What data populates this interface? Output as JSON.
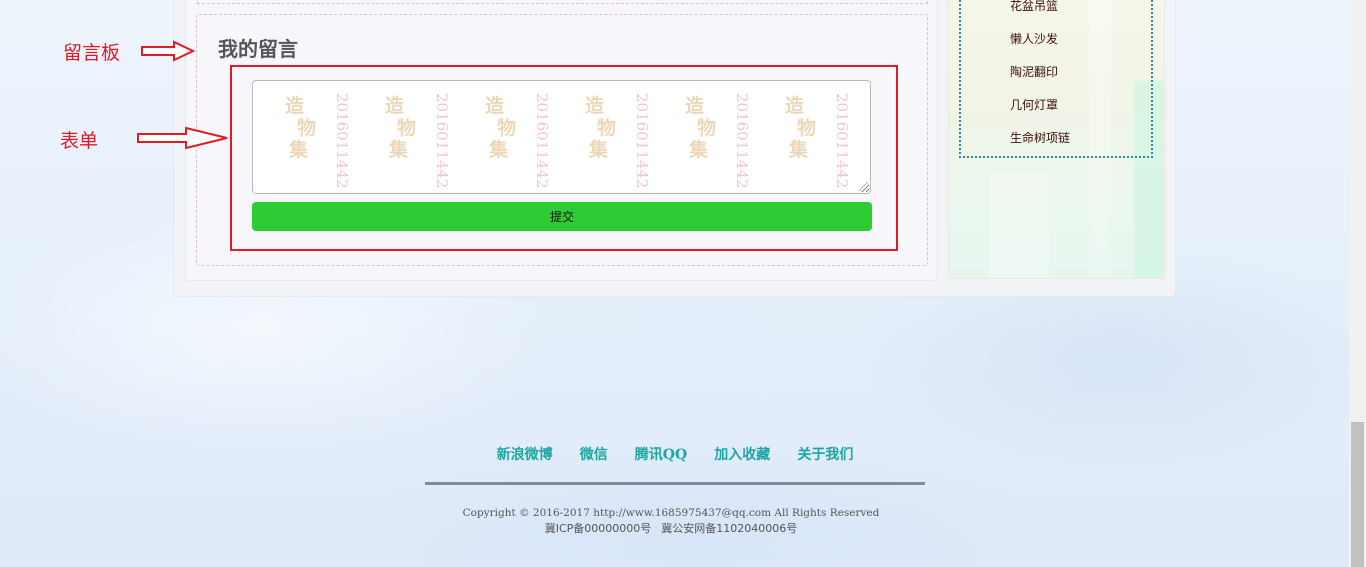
{
  "guestbook": {
    "title": "我的留言",
    "submit_label": "提交"
  },
  "watermark": {
    "logo_chars": [
      "造",
      "物",
      "集"
    ],
    "id_text": "2016011442"
  },
  "annotations": {
    "guestbook_label": "留言板",
    "form_label": "表单",
    "color": "#e01b24"
  },
  "sidebar": {
    "items": [
      {
        "label": "花盆吊篮"
      },
      {
        "label": "懒人沙发"
      },
      {
        "label": "陶泥翻印"
      },
      {
        "label": "几何灯罩"
      },
      {
        "label": "生命树项链"
      }
    ]
  },
  "footer": {
    "links": [
      "新浪微博",
      "微信",
      "腾讯QQ",
      "加入收藏",
      "关于我们"
    ],
    "copyright": "Copyright © 2016-2017 http://www.1685975437@qq.com All Rights Reserved",
    "icp": "冀ICP备00000000号",
    "police": "冀公安网备1102040006号"
  },
  "colors": {
    "submit_button": "#2ecc34",
    "footer_link": "#1aa7a4",
    "sidebar_border": "#2a8f9a"
  }
}
